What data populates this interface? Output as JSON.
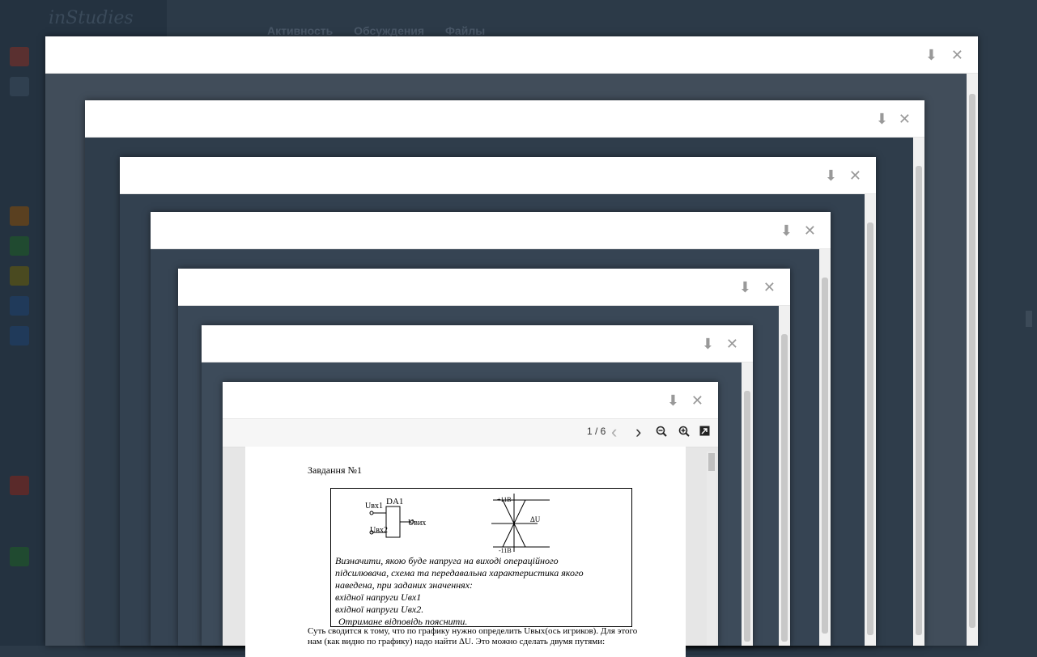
{
  "background": {
    "logo": "inStudies",
    "nav": [
      "Активность",
      "Обсуждения",
      "Файлы"
    ]
  },
  "modals": [
    {
      "id": "m1"
    },
    {
      "id": "m2"
    },
    {
      "id": "m3"
    },
    {
      "id": "m4"
    },
    {
      "id": "m5"
    },
    {
      "id": "m6"
    },
    {
      "id": "m7"
    }
  ],
  "icons": {
    "download": "⬇",
    "close": "✕"
  },
  "viewer": {
    "page_indicator": "1 / 6",
    "prev": "‹",
    "next": "›",
    "zoom_out": "🔍",
    "zoom_in": "🔍",
    "popout": "⬈"
  },
  "doc": {
    "task_title": "Завдання №1",
    "circuit_label": "DA1",
    "u_in1": "Uвх1",
    "u_in2": "Uвх2",
    "u_out": "Uвих",
    "plus11": "+11В",
    "minus11": "-11В",
    "delta_u": "ΔU",
    "task_line1": "Визначити, якою буде напруга на виході операційного",
    "task_line2": "підсилювача, схема та передавальна характеристика якого",
    "task_line3": "наведена, при заданих значеннях:",
    "task_line4": "вхідної напруги Uвх1",
    "task_line5": "вхідної напруги Uвх2.",
    "task_line6": "Отримане відповідь пояснити.",
    "answer1": "Суть сводится к тому, что по графику нужно определить Uвых(ось игриков). Для этого",
    "answer2": "нам (как видно по графику) надо найти ΔU. Это можно сделать двумя путями:"
  }
}
